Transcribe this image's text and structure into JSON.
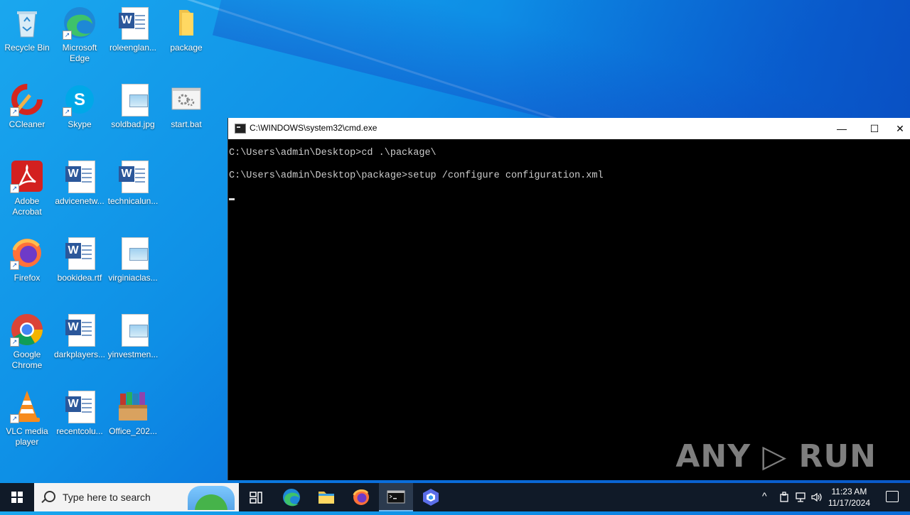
{
  "desktop": {
    "icons": [
      {
        "label": "Recycle Bin",
        "icon": "recycle-bin-icon"
      },
      {
        "label": "Microsoft\nEdge",
        "icon": "edge-icon"
      },
      {
        "label": "roleenglan...",
        "icon": "word-doc-icon"
      },
      {
        "label": "package",
        "icon": "folder-icon"
      },
      {
        "label": "CCleaner",
        "icon": "ccleaner-icon"
      },
      {
        "label": "Skype",
        "icon": "skype-icon"
      },
      {
        "label": "soldbad.jpg",
        "icon": "image-file-icon"
      },
      {
        "label": "start.bat",
        "icon": "batch-file-icon"
      },
      {
        "label": "Adobe\nAcrobat",
        "icon": "acrobat-icon"
      },
      {
        "label": "advicenetw...",
        "icon": "word-doc-icon"
      },
      {
        "label": "technicalun...",
        "icon": "word-doc-icon"
      },
      {
        "label": "Firefox",
        "icon": "firefox-icon"
      },
      {
        "label": "bookidea.rtf",
        "icon": "word-doc-icon"
      },
      {
        "label": "virginiaclas...",
        "icon": "image-file-icon"
      },
      {
        "label": "Google\nChrome",
        "icon": "chrome-icon"
      },
      {
        "label": "darkplayers...",
        "icon": "word-doc-icon"
      },
      {
        "label": "yinvestmen...",
        "icon": "image-file-icon"
      },
      {
        "label": "VLC media\nplayer",
        "icon": "vlc-icon"
      },
      {
        "label": "recentcolu...",
        "icon": "word-doc-icon"
      },
      {
        "label": "Office_202...",
        "icon": "archive-icon"
      }
    ]
  },
  "cmd_window": {
    "title": "C:\\WINDOWS\\system32\\cmd.exe",
    "minimize": "—",
    "maximize": "☐",
    "close": "✕",
    "lines": [
      "C:\\Users\\admin\\Desktop>cd .\\package\\",
      "C:\\Users\\admin\\Desktop\\package>setup /configure configuration.xml"
    ]
  },
  "watermark": "ANY ▷ RUN",
  "taskbar": {
    "search_placeholder": "Type here to search",
    "time": "11:23 AM",
    "date": "11/17/2024",
    "tray_chevron": "^"
  },
  "colors": {
    "desktop_bg": "#0e8fe6",
    "taskbar_bg": "#101a28",
    "terminal_text": "#cccccc"
  }
}
